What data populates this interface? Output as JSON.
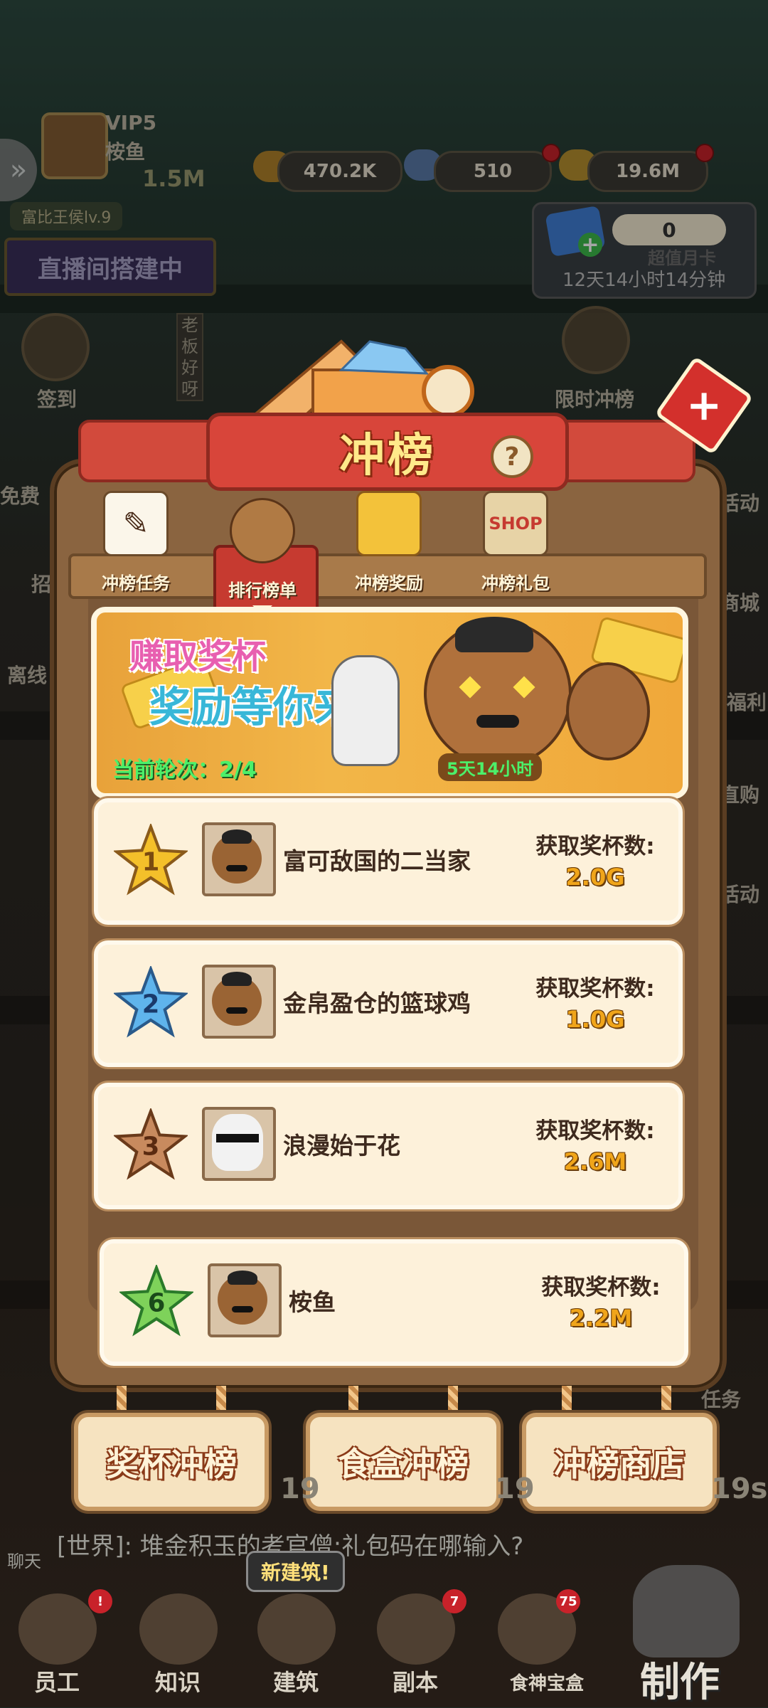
{
  "player": {
    "vip": "VIP5",
    "name": "桉鱼",
    "power": "1.5M",
    "rank_title": "富比王侯lv.9"
  },
  "currencies": {
    "trophies": "470.2K",
    "gems": "510",
    "coins": "19.6M"
  },
  "monthly_card": {
    "value": "0",
    "label": "超值月卡",
    "countdown": "12天14小时14分钟"
  },
  "live_banner": "直播间搭建中",
  "side_left": [
    "签到",
    "免费",
    "招",
    "离线"
  ],
  "side_right": [
    "限时冲榜",
    "活动",
    "商城",
    "福利",
    "直购",
    "活动",
    "任务"
  ],
  "decor_sign": "老板好呀",
  "panel": {
    "title": "冲榜",
    "help": "?",
    "close": "+"
  },
  "tabs": [
    {
      "label": "冲榜任务",
      "icon": "document-quill-icon"
    },
    {
      "label": "排行榜单",
      "icon": "bear-mascot-icon"
    },
    {
      "label": "冲榜奖励",
      "icon": "treasure-icon"
    },
    {
      "label": "冲榜礼包",
      "icon": "shop-stall-icon",
      "icon_text": "SHOP"
    }
  ],
  "active_tab": "排行榜单",
  "banner": {
    "line1": "赚取奖杯",
    "line2": "奖励等你来领",
    "round_label": "当前轮次：",
    "round_value": "2/4",
    "timer": "5天14小时"
  },
  "ranking": [
    {
      "rank": "1",
      "name": "富可敌国的二当家",
      "count_label": "获取奖杯数:",
      "count": "2.0G",
      "avatar": "bear-mustache-avatar",
      "star_color": "#f4c02a"
    },
    {
      "rank": "2",
      "name": "金帛盈仓的篮球鸡",
      "count_label": "获取奖杯数:",
      "count": "1.0G",
      "avatar": "bear-mustache-avatar",
      "star_color": "#5fb4ec"
    },
    {
      "rank": "3",
      "name": "浪漫始于花",
      "count_label": "获取奖杯数:",
      "count": "2.6M",
      "avatar": "white-hair-avatar",
      "star_color": "#c88a5e"
    }
  ],
  "my_rank": {
    "rank": "6",
    "name": "桉鱼",
    "count_label": "获取奖杯数:",
    "count": "2.2M",
    "avatar": "bear-mustache-avatar",
    "star_color": "#7ed25a"
  },
  "bottom_buttons": [
    "奖杯冲榜",
    "食盒冲榜",
    "冲榜商店"
  ],
  "chat": {
    "label": "聊天",
    "message": "[世界]:  堆金积玉的考官僧:礼包码在哪输入?"
  },
  "build_tip": "新建筑!",
  "nav": [
    {
      "label": "员工",
      "badge": "!"
    },
    {
      "label": "知识",
      "badge": ""
    },
    {
      "label": "建筑",
      "badge": ""
    },
    {
      "label": "副本",
      "badge": "7"
    },
    {
      "label": "食神宝盒",
      "badge": "75"
    }
  ],
  "make_label": "制作",
  "bg_timer_labels": [
    "19",
    "19",
    "19s"
  ],
  "colors": {
    "panel_brown": "#8a6440",
    "ribbon_red": "#d24a3c",
    "title_yellow": "#ffe98a",
    "card_cream": "#fdf1da",
    "count_gold": "#f0a51a"
  }
}
